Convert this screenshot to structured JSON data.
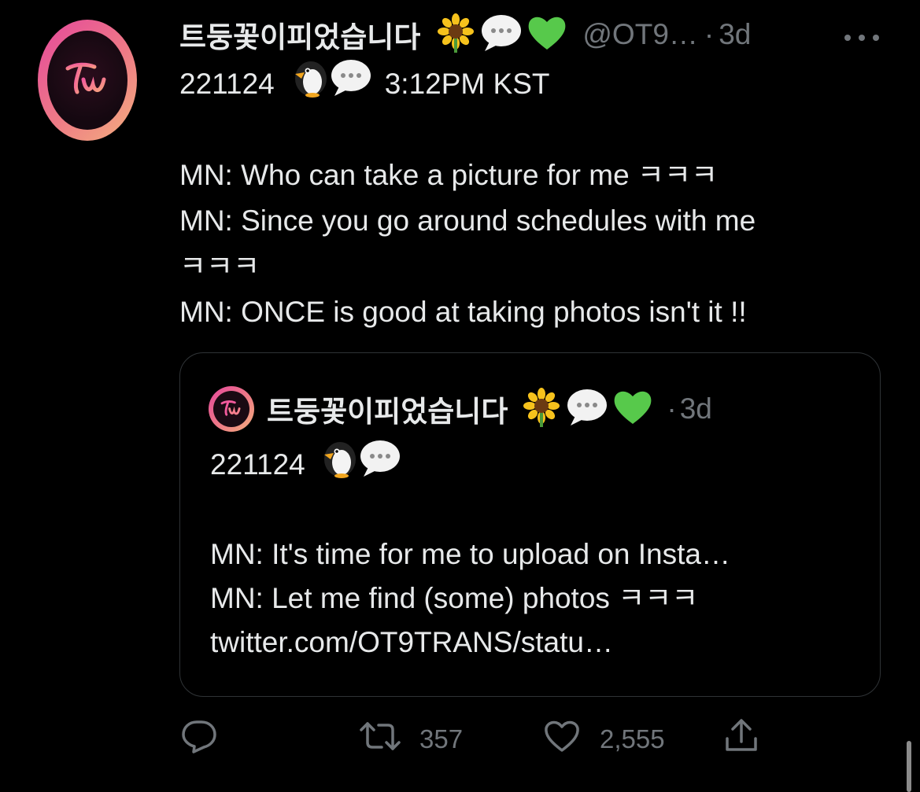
{
  "tweet": {
    "display_name": "트둥꽃이피었습니다",
    "handle": "@OT9…",
    "separator": "·",
    "time": "3d",
    "lines": [
      "221124",
      "3:12PM KST",
      "MN: Who can take a picture for me ㅋㅋㅋ",
      "MN: Since you go around schedules with me",
      "ㅋㅋㅋ",
      "MN: ONCE is good at taking photos isn't it !!"
    ]
  },
  "quoted": {
    "display_name": "트둥꽃이피었습니다",
    "separator": "·",
    "time": "3d",
    "date_line": "221124",
    "lines": [
      "MN: It's time for me to upload on Insta…",
      "MN: Let me find (some) photos ㅋㅋㅋ",
      "twitter.com/OT9TRANS/statu…"
    ]
  },
  "actions": {
    "reply_icon": "reply-icon",
    "retweet_count": "357",
    "like_count": "2,555",
    "share_icon": "share-icon"
  },
  "colors": {
    "background": "#000000",
    "text": "#e7e9ea",
    "muted": "#71767b",
    "border": "#2f3336",
    "avatar_gradient_start": "#e5479c",
    "avatar_gradient_end": "#f4b07e"
  }
}
